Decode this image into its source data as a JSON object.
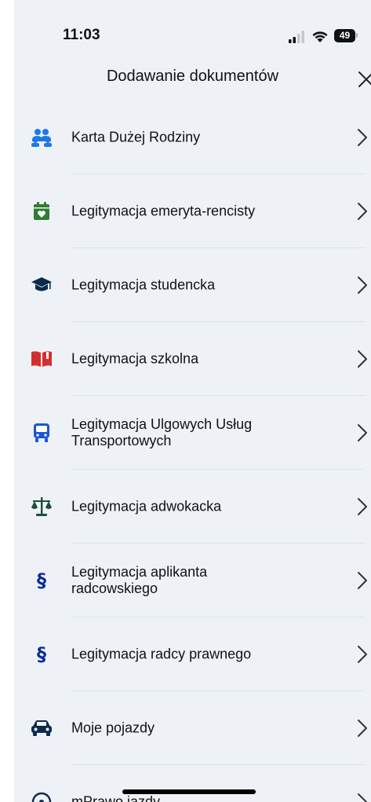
{
  "status_bar": {
    "time": "11:03",
    "battery": "49"
  },
  "header": {
    "title": "Dodawanie dokumentów"
  },
  "items": [
    {
      "label": "Karta Dużej Rodziny",
      "icon": "family-icon"
    },
    {
      "label": "Legitymacja emeryta-rencisty",
      "icon": "calendar-heart-icon"
    },
    {
      "label": "Legitymacja studencka",
      "icon": "graduation-cap-icon"
    },
    {
      "label": "Legitymacja szkolna",
      "icon": "open-book-icon"
    },
    {
      "label": "Legitymacja Ulgowych Usług Transportowych",
      "icon": "bus-icon"
    },
    {
      "label": "Legitymacja adwokacka",
      "icon": "scales-icon"
    },
    {
      "label": "Legitymacja aplikanta radcowskiego",
      "icon": "paragraph-icon"
    },
    {
      "label": "Legitymacja radcy prawnego",
      "icon": "paragraph-icon"
    },
    {
      "label": "Moje pojazdy",
      "icon": "car-icon"
    },
    {
      "label": "mPrawo jazdy",
      "icon": "steering-wheel-icon"
    }
  ],
  "colors": {
    "background": "#eef2f6",
    "family_icon": "#1f78e6",
    "calendar_icon": "#2e7d32",
    "graduation_icon": "#0c2b4c",
    "book_icon": "#d32f2f",
    "bus_icon": "#1a56d6",
    "scales_icon": "#1f4d3a",
    "paragraph_icon": "#0d2a9c",
    "car_icon": "#0c2b4c"
  }
}
